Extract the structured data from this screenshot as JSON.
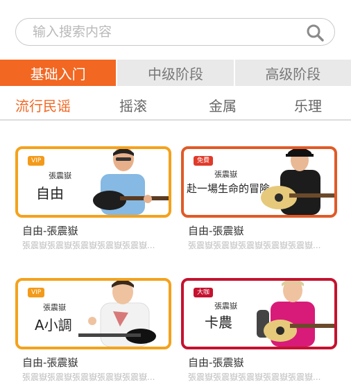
{
  "search": {
    "placeholder": "输入搜索内容"
  },
  "level_tabs": [
    "基础入门",
    "中级阶段",
    "高级阶段"
  ],
  "category_tabs": [
    "流行民谣",
    "摇滚",
    "金属",
    "乐理"
  ],
  "colors": {
    "accent": "#f26722",
    "vip": "#f39a1a",
    "free": "#e03a2a",
    "master": "#c4122f"
  },
  "cards": [
    {
      "badge": "VIP",
      "teacher": "張震嶽",
      "song": "自由",
      "title": "自由-張震嶽",
      "subtitle": "張震嶽張震嶽張震嶽張震嶽張震嶽..."
    },
    {
      "badge": "免費",
      "teacher": "張震嶽",
      "song": "赴一場生命的冒險",
      "title": "自由-張震嶽",
      "subtitle": "張震嶽張震嶽張震嶽張震嶽張震嶽..."
    },
    {
      "badge": "VIP",
      "teacher": "張震嶽",
      "song": "A小調",
      "title": "自由-張震嶽",
      "subtitle": "張震嶽張震嶽張震嶽張震嶽張震嶽..."
    },
    {
      "badge": "大咖",
      "teacher": "張震嶽",
      "song": "卡農",
      "title": "自由-張震嶽",
      "subtitle": "張震嶽張震嶽張震嶽張震嶽張震嶽..."
    }
  ]
}
